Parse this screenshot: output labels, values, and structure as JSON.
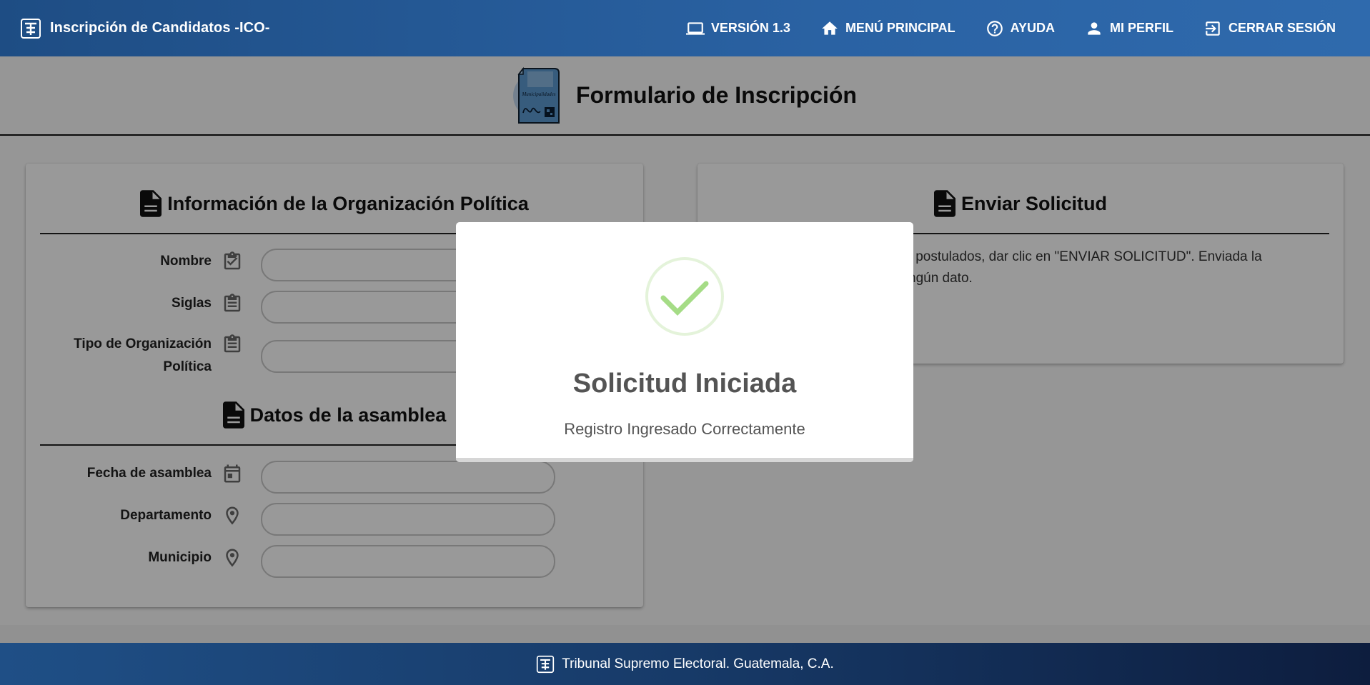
{
  "topbar": {
    "title": "Inscripción de Candidatos -ICO-",
    "nav": [
      {
        "label": "VERSIÓN 1.3",
        "icon": "laptop-icon"
      },
      {
        "label": "MENÚ PRINCIPAL",
        "icon": "home-icon"
      },
      {
        "label": "AYUDA",
        "icon": "help-icon"
      },
      {
        "label": "MI PERFIL",
        "icon": "person-icon"
      },
      {
        "label": "CERRAR SESIÓN",
        "icon": "logout-icon"
      }
    ]
  },
  "page": {
    "title": "Formulario de Inscripción",
    "logo_text": "Municipalidades"
  },
  "left": {
    "org_title": "Información de la Organización Política",
    "fields_org": [
      {
        "label": "Nombre",
        "icon": "clipboard-check-icon",
        "value": ""
      },
      {
        "label": "Siglas",
        "icon": "clipboard-list-icon",
        "value": ""
      },
      {
        "label": "Tipo de Organización Política",
        "label_line1": "Tipo de Organización",
        "label_line2": "Política",
        "icon": "clipboard-list-icon",
        "value": ""
      }
    ],
    "asamblea_title": "Datos de la asamblea",
    "fields_asamblea": [
      {
        "label": "Fecha de asamblea",
        "icon": "calendar-icon",
        "value": ""
      },
      {
        "label": "Departamento",
        "icon": "location-pin-icon",
        "value": ""
      },
      {
        "label": "Municipio",
        "icon": "location-pin-icon",
        "value": ""
      }
    ]
  },
  "right": {
    "title": "Enviar Solicitud",
    "text_line1": "atos postulados, dar clic en \"ENVIAR SOLICITUD\". Enviada la",
    "text_line2": "ngún dato."
  },
  "footer": {
    "text": "Tribunal Supremo Electoral. Guatemala, C.A."
  },
  "modal": {
    "title": "Solicitud Iniciada",
    "message": "Registro Ingresado Correctamente"
  },
  "colors": {
    "topbar": "#2a62a3",
    "footer": "#173a68",
    "success": "#a5dc86",
    "modal_text": "#545454"
  }
}
